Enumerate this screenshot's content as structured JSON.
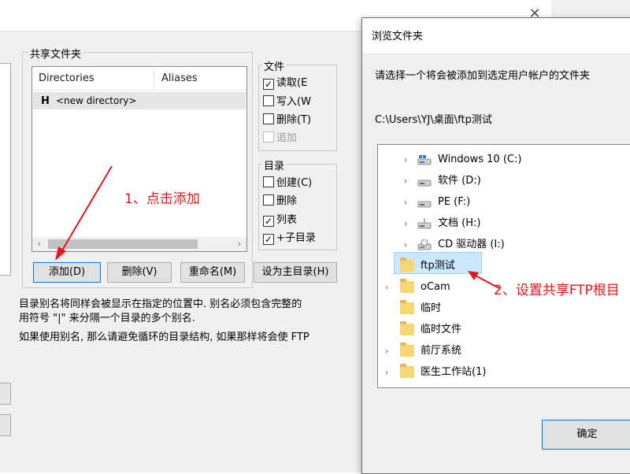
{
  "main": {
    "shared_folder_label": "共享文件夹",
    "columns": [
      "Directories",
      "Aliases"
    ],
    "row_prefix": "H",
    "row_text": "<new directory>",
    "buttons": {
      "add": "添加(D)",
      "delete": "删除(V)",
      "rename": "重命名(M)",
      "set_home": "设为主目录(H)"
    },
    "files_label": "文件",
    "file_checks": [
      {
        "label": "读取(E",
        "checked": true,
        "disabled": false
      },
      {
        "label": "写入(W",
        "checked": false,
        "disabled": false
      },
      {
        "label": "删除(T)",
        "checked": false,
        "disabled": false
      },
      {
        "label": "追加",
        "checked": false,
        "disabled": true
      }
    ],
    "dirs_label": "目录",
    "dir_checks": [
      {
        "label": "创建(C)",
        "checked": false
      },
      {
        "label": "删除",
        "checked": false
      },
      {
        "label": "列表",
        "checked": true
      },
      {
        "label": "+子目录",
        "checked": true
      }
    ],
    "desc_line1": "目录别名将同样会被显示在指定的位置中. 别名必须包含完整的",
    "desc_line2": "用符号 \"|\" 来分隔一个目录的多个别名.",
    "desc_line3": "如果使用别名, 那么请避免循环的目录结构, 如果那样将会使 FTP"
  },
  "annotations": {
    "step1": "1、点击添加",
    "step2": "2、设置共享FTP根目"
  },
  "dialog": {
    "title": "浏览文件夹",
    "instruction": "请选择一个将会被添加到选定用户帐户的文件夹",
    "path": "C:\\Users\\YJ\\桌面\\ftp测试",
    "tree": [
      {
        "label": "Windows 10 (C:)",
        "kind": "drive-win"
      },
      {
        "label": "软件 (D:)",
        "kind": "drive"
      },
      {
        "label": "PE (F:)",
        "kind": "drive"
      },
      {
        "label": "文档 (H:)",
        "kind": "drive-net"
      },
      {
        "label": "CD 驱动器 (I:)",
        "kind": "cd"
      },
      {
        "label": "ftp测试",
        "kind": "folder",
        "selected": true
      },
      {
        "label": "oCam",
        "kind": "folder"
      },
      {
        "label": "临时",
        "kind": "folder"
      },
      {
        "label": "临时文件",
        "kind": "folder"
      },
      {
        "label": "前厅系统",
        "kind": "folder"
      },
      {
        "label": "医生工作站(1)",
        "kind": "folder"
      }
    ],
    "ok_label": "确定"
  },
  "colors": {
    "annotation": "#e8141a",
    "selection": "#cce8ff",
    "accent": "#0078d7"
  }
}
